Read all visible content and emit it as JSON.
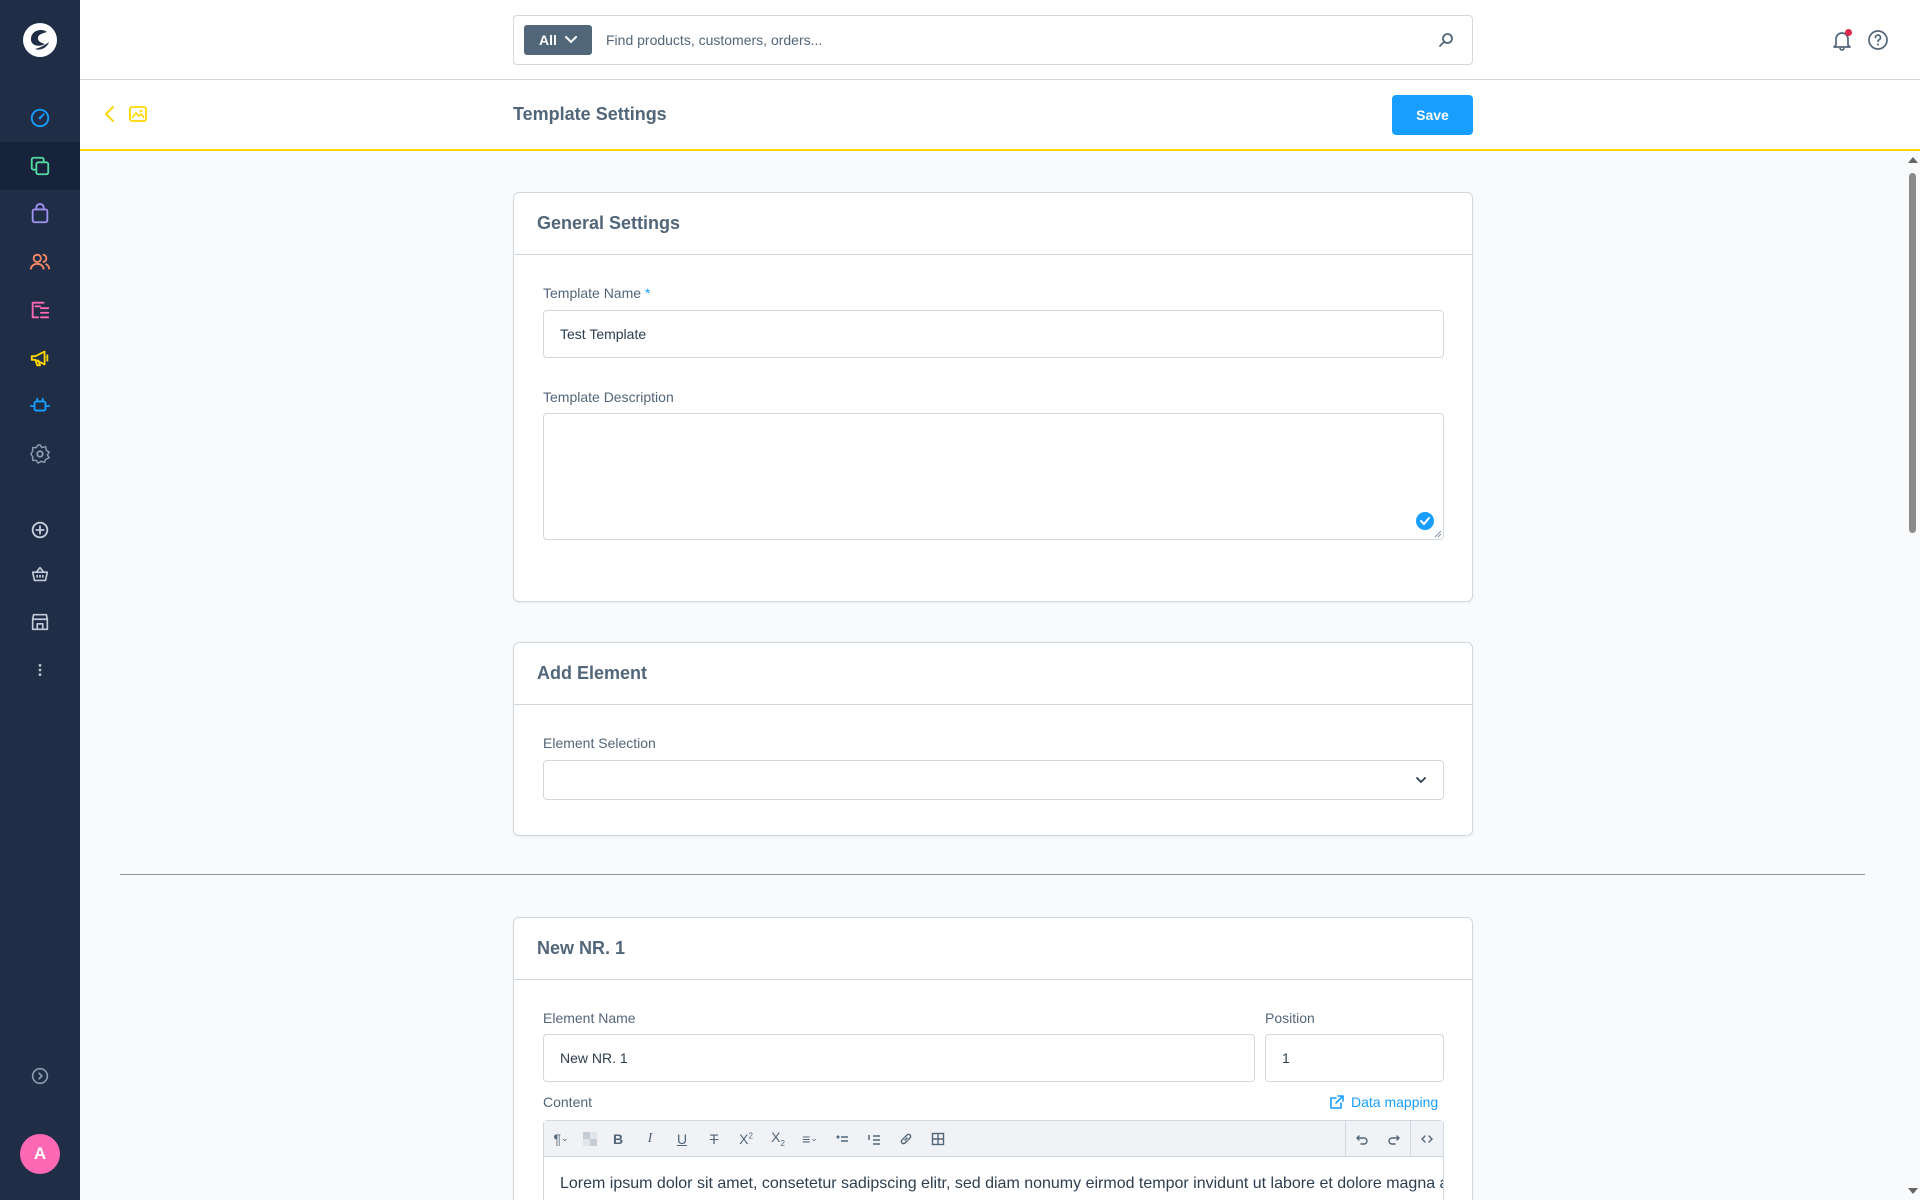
{
  "colors": {
    "sidebar_bg": "#1f2d46",
    "accent": "#189eff",
    "smartbar_border": "#ffd700",
    "avatar_bg": "#ff68b4"
  },
  "sidebar": {
    "items": [
      {
        "name": "dashboard-icon"
      },
      {
        "name": "catalogues-icon",
        "active": true
      },
      {
        "name": "orders-icon"
      },
      {
        "name": "customers-icon"
      },
      {
        "name": "content-icon"
      },
      {
        "name": "marketing-icon"
      },
      {
        "name": "extensions-icon"
      },
      {
        "name": "settings-icon"
      },
      {
        "name": "add-circle-icon"
      },
      {
        "name": "basket-icon"
      },
      {
        "name": "storefront-icon"
      },
      {
        "name": "more-icon"
      },
      {
        "name": "expand-menu-icon"
      }
    ],
    "avatar_initial": "A"
  },
  "topbar": {
    "search_type": "All",
    "search_placeholder": "Find products, customers, orders..."
  },
  "smartbar": {
    "title": "Template Settings",
    "save_label": "Save"
  },
  "general": {
    "heading": "General Settings",
    "name_label": "Template Name",
    "required_mark": "*",
    "name_value": "Test Template",
    "description_label": "Template Description"
  },
  "add_element": {
    "heading": "Add Element",
    "selection_label": "Element Selection"
  },
  "element": {
    "heading": "New NR. 1",
    "name_label": "Element Name",
    "name_value": "New  NR. 1",
    "position_label": "Position",
    "position_value": "1",
    "content_label": "Content",
    "data_mapping_label": "Data mapping",
    "content_text": "Lorem ipsum dolor sit amet, consetetur sadipscing elitr, sed diam nonumy eirmod tempor invidunt ut labore et dolore magna aliquyam erat, sed diam voluptua. At vero eos et accusam et justo duo dolores et ea rebum. Stet"
  }
}
